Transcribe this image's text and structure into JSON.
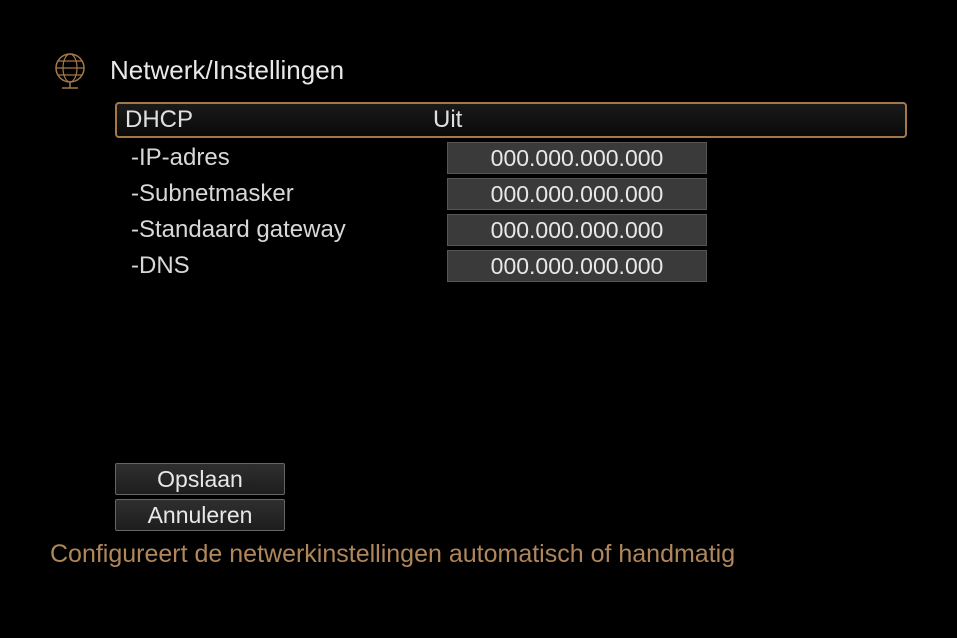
{
  "title": "Netwerk/Instellingen",
  "dhcp": {
    "label": "DHCP",
    "value": "Uit"
  },
  "fields": [
    {
      "label": "-IP-adres",
      "value": "000.000.000.000"
    },
    {
      "label": "-Subnetmasker",
      "value": "000.000.000.000"
    },
    {
      "label": "-Standaard gateway",
      "value": "000.000.000.000"
    },
    {
      "label": "-DNS",
      "value": "000.000.000.000"
    }
  ],
  "buttons": {
    "save": "Opslaan",
    "cancel": "Annuleren"
  },
  "help_text": "Configureert de netwerkinstellingen automatisch of handmatig"
}
